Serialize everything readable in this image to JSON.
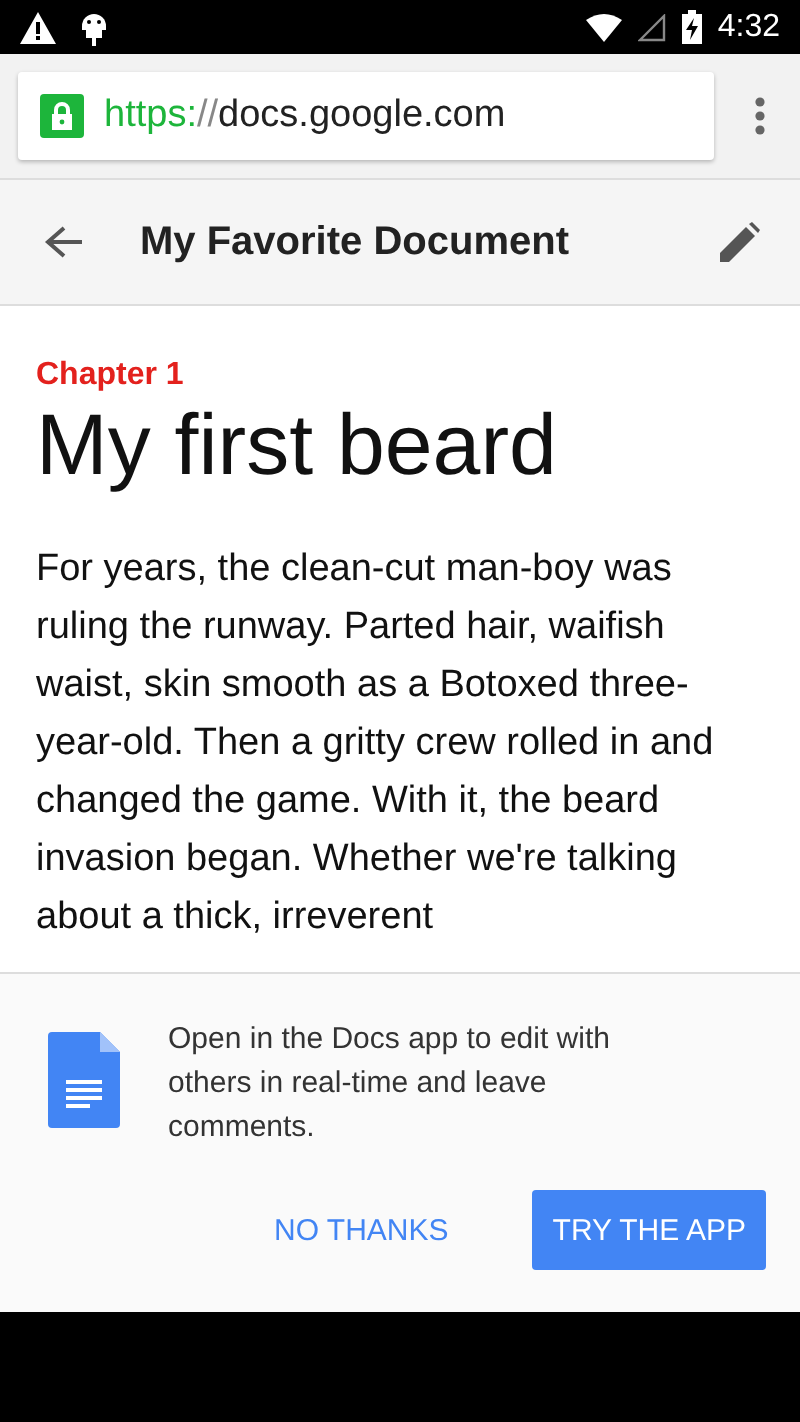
{
  "status_bar": {
    "time": "4:32"
  },
  "address_bar": {
    "secure": true,
    "scheme": "https:",
    "separator": "//",
    "host": "docs.google.com"
  },
  "app_bar": {
    "title": "My Favorite Document"
  },
  "document": {
    "chapter": "Chapter 1",
    "heading": "My first beard",
    "paragraph": "For years, the clean-cut man-boy was ruling the runway. Parted hair, waifish waist, skin smooth as a Botoxed three-year-old. Then a gritty crew rolled in and changed the game. With it, the beard invasion began. Whether we're talking about a thick, irreverent"
  },
  "banner": {
    "message": "Open in the Docs app to edit with others in real-time and leave comments.",
    "buttons": [
      {
        "kind": "text",
        "label": "NO THANKS"
      },
      {
        "kind": "filled",
        "label": "TRY THE APP"
      }
    ]
  }
}
